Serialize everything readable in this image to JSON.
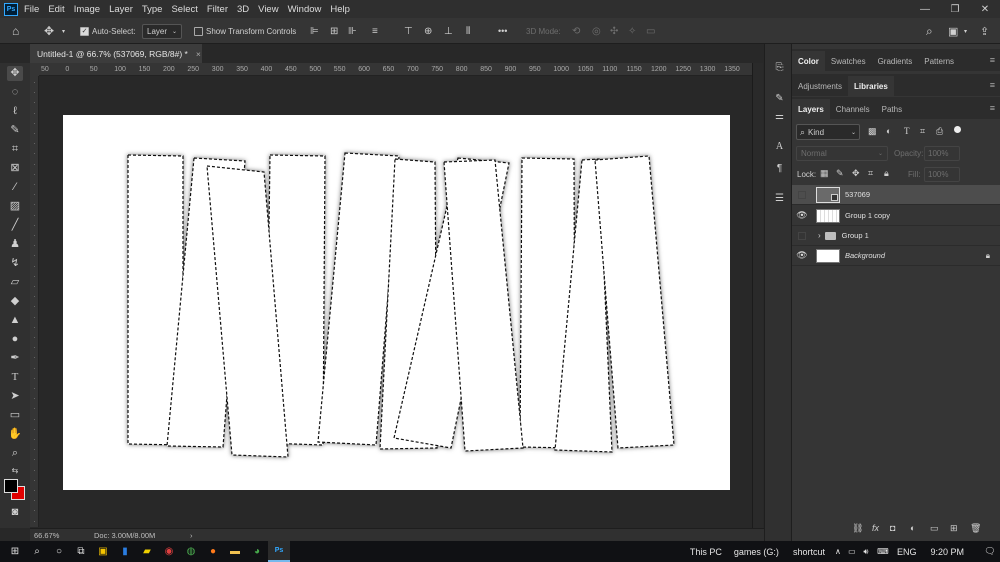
{
  "menubar": {
    "app_logo": "Ps",
    "items": [
      "File",
      "Edit",
      "Image",
      "Layer",
      "Type",
      "Select",
      "Filter",
      "3D",
      "View",
      "Window",
      "Help"
    ],
    "window_controls": [
      "—",
      "❐",
      "✕"
    ]
  },
  "options": {
    "auto_select_label": "Auto-Select:",
    "auto_select_checked": true,
    "target_value": "Layer",
    "transform_label": "Show Transform Controls",
    "transform_checked": false,
    "more": "•••",
    "mode_label": "3D Mode:"
  },
  "document": {
    "tab_title": "Untitled-1 @ 66.7% (537069, RGB/8#) *",
    "close_label": "×"
  },
  "rulers": {
    "top_labels": [
      "50",
      "0",
      "50",
      "100",
      "150",
      "200",
      "250",
      "300",
      "350",
      "400",
      "450",
      "500",
      "550",
      "600",
      "650",
      "700",
      "750",
      "800",
      "850",
      "900",
      "950",
      "1000",
      "1050",
      "1100",
      "1150",
      "1200",
      "1250",
      "1300",
      "1350"
    ]
  },
  "status": {
    "zoom": "66.67%",
    "doc": "Doc: 3.00M/8.00M",
    "arrow": "›"
  },
  "panels": {
    "row1_tabs": [
      "Color",
      "Swatches",
      "Gradients",
      "Patterns"
    ],
    "row2_tabs": [
      "Adjustments",
      "Libraries"
    ],
    "row3_tabs": [
      "Layers",
      "Channels",
      "Paths"
    ],
    "filter_kind": "Kind",
    "blend_mode": "Normal",
    "opacity_label": "Opacity:",
    "opacity_value": "100%",
    "lock_label": "Lock:",
    "fill_label": "Fill:",
    "fill_value": "100%",
    "layers": [
      {
        "name": "537069",
        "visible": false,
        "selected": true
      },
      {
        "name": "Group 1 copy",
        "visible": true,
        "selected": false
      },
      {
        "name": "Group 1",
        "visible": false,
        "selected": false
      },
      {
        "name": "Background",
        "visible": true,
        "selected": false
      }
    ]
  },
  "taskbar": {
    "this_pc": "This PC",
    "games": "games (G:)",
    "shortcut": "shortcut",
    "lang": "ENG",
    "time": "9:20 PM"
  }
}
